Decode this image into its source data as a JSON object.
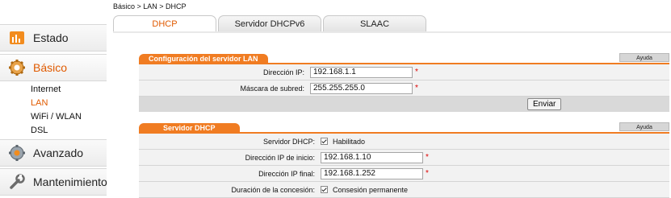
{
  "sidebar": {
    "items": [
      {
        "label": "Estado"
      },
      {
        "label": "Básico"
      },
      {
        "label": "Avanzado"
      },
      {
        "label": "Mantenimiento"
      }
    ],
    "subitems": [
      {
        "label": "Internet"
      },
      {
        "label": "LAN"
      },
      {
        "label": "WiFi / WLAN"
      },
      {
        "label": "DSL"
      }
    ]
  },
  "breadcrumb": "Básico > LAN > DHCP",
  "tabs": [
    {
      "label": "DHCP"
    },
    {
      "label": "Servidor DHCPv6"
    },
    {
      "label": "SLAAC"
    }
  ],
  "lan": {
    "title": "Configuración del servidor LAN",
    "help": "Ayuda",
    "ip_label": "Dirección IP:",
    "ip_value": "192.168.1.1",
    "mask_label": "Máscara de subred:",
    "mask_value": "255.255.255.0",
    "submit": "Enviar",
    "required": "*"
  },
  "dhcp": {
    "title": "Servidor DHCP",
    "help": "Ayuda",
    "server_label": "Servidor DHCP:",
    "server_check": "Habilitado",
    "start_label": "Dirección IP de inicio:",
    "start_value": "192.168.1.10",
    "end_label": "Dirección IP final:",
    "end_value": "192.168.1.252",
    "lease_label": "Duración de la concesión:",
    "lease_check": "Consesión permanente",
    "required": "*"
  },
  "colors": {
    "accent": "#f07c22",
    "active_text": "#e05a00"
  }
}
